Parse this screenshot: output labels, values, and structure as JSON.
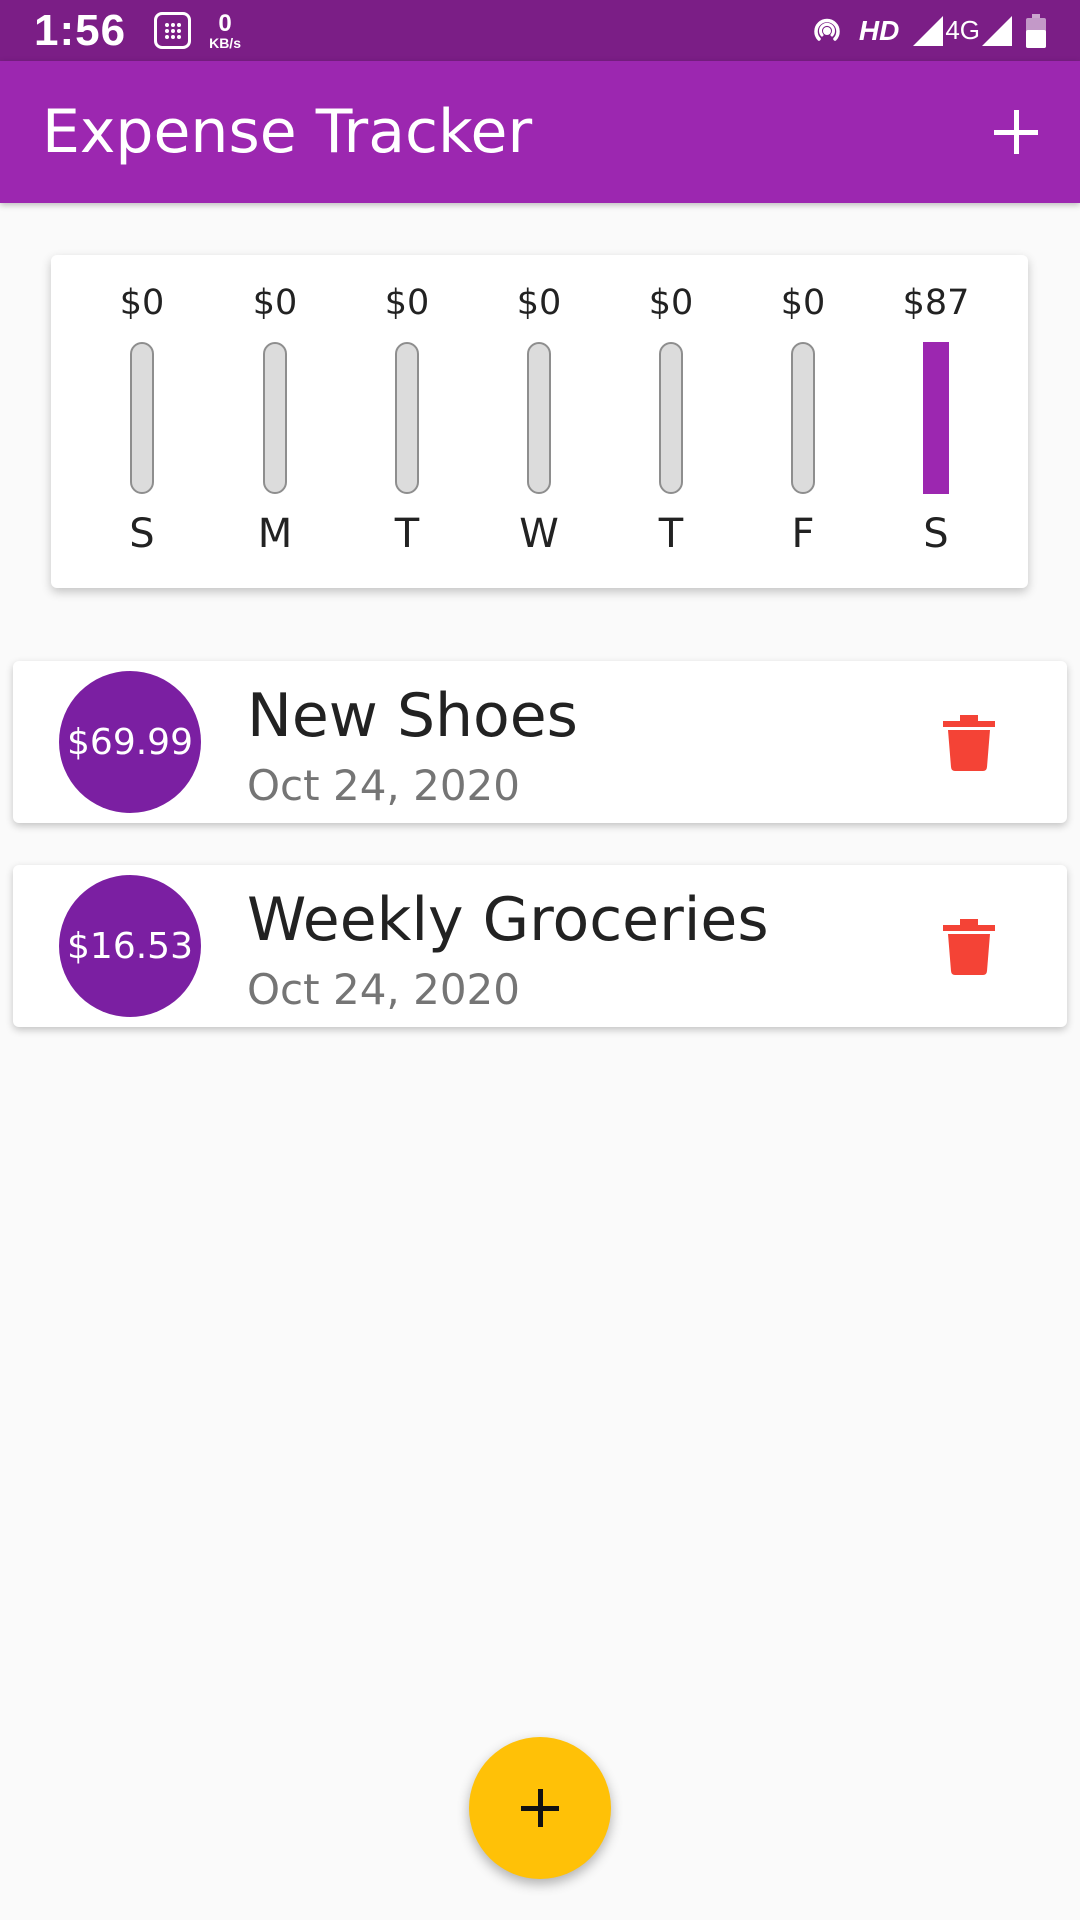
{
  "status_bar": {
    "time": "1:56",
    "speed_value": "0",
    "speed_unit": "KB/s",
    "hd_label": "HD",
    "network_label": "4G",
    "icons": [
      "calculator-icon",
      "hotspot-icon",
      "signal-icon",
      "battery-icon"
    ]
  },
  "app_bar": {
    "title": "Expense Tracker",
    "add_icon": "plus-icon"
  },
  "chart_data": {
    "type": "bar",
    "categories": [
      "S",
      "M",
      "T",
      "W",
      "T",
      "F",
      "S"
    ],
    "amount_labels": [
      "$0",
      "$0",
      "$0",
      "$0",
      "$0",
      "$0",
      "$87"
    ],
    "values": [
      0,
      0,
      0,
      0,
      0,
      0,
      86.52
    ],
    "fill_fraction": [
      0,
      0,
      0,
      0,
      0,
      0,
      1
    ],
    "colors": {
      "fill": "#9c27b0",
      "track": "#dcdcdc"
    }
  },
  "transactions": [
    {
      "amount": "$69.99",
      "title": "New Shoes",
      "date": "Oct 24, 2020",
      "delete_icon": "trash-icon"
    },
    {
      "amount": "$16.53",
      "title": "Weekly Groceries",
      "date": "Oct 24, 2020",
      "delete_icon": "trash-icon"
    }
  ],
  "fab": {
    "icon": "plus-icon",
    "color": "#ffc107"
  },
  "colors": {
    "primary": "#9c27b0",
    "primary_dark": "#7b1e86",
    "accent": "#ffc107",
    "delete": "#f44336"
  }
}
